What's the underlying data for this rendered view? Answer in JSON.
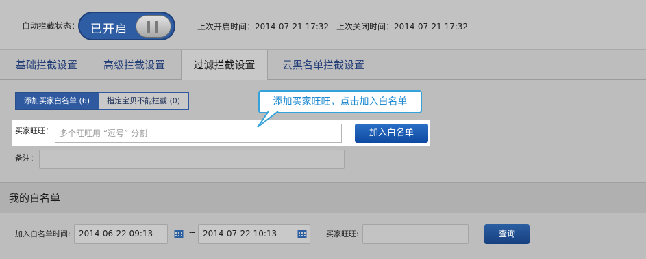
{
  "status": {
    "label": "自动拦截状态：",
    "toggle_text": "已开启",
    "last_open": "上次开启时间：2014-07-21 17:32",
    "last_close": "上次关闭时间：2014-07-21 17:32"
  },
  "tabs": [
    {
      "label": "基础拦截设置"
    },
    {
      "label": "高级拦截设置"
    },
    {
      "label": "过滤拦截设置"
    },
    {
      "label": "云黑名单拦截设置"
    }
  ],
  "active_tab": "过滤拦截设置",
  "subtabs": [
    {
      "label": "添加买家白名单 (6)"
    },
    {
      "label": "指定宝贝不能拦截 (0)"
    }
  ],
  "form": {
    "buyer_label": "买家旺旺：",
    "buyer_placeholder": "多个旺旺用 “逗号” 分割",
    "add_button": "加入白名单",
    "remark_label": "备注：",
    "tooltip": "添加买家旺旺，点击加入白名单"
  },
  "whitelist": {
    "title": "我的白名单",
    "time_label": "加入白名单时间:",
    "date_from": "2014-06-22 09:13",
    "separator": "--",
    "date_to": "2014-07-22 10:13",
    "buyer_label": "买家旺旺:",
    "query_button": "查询"
  },
  "icons": {
    "calendar": "calendar-icon",
    "toggle_knob": "toggle-knob-icon"
  },
  "colors": {
    "accent": "#2f5da3",
    "tooltip_border": "#35a2dc",
    "button": "#0f4aa1"
  }
}
